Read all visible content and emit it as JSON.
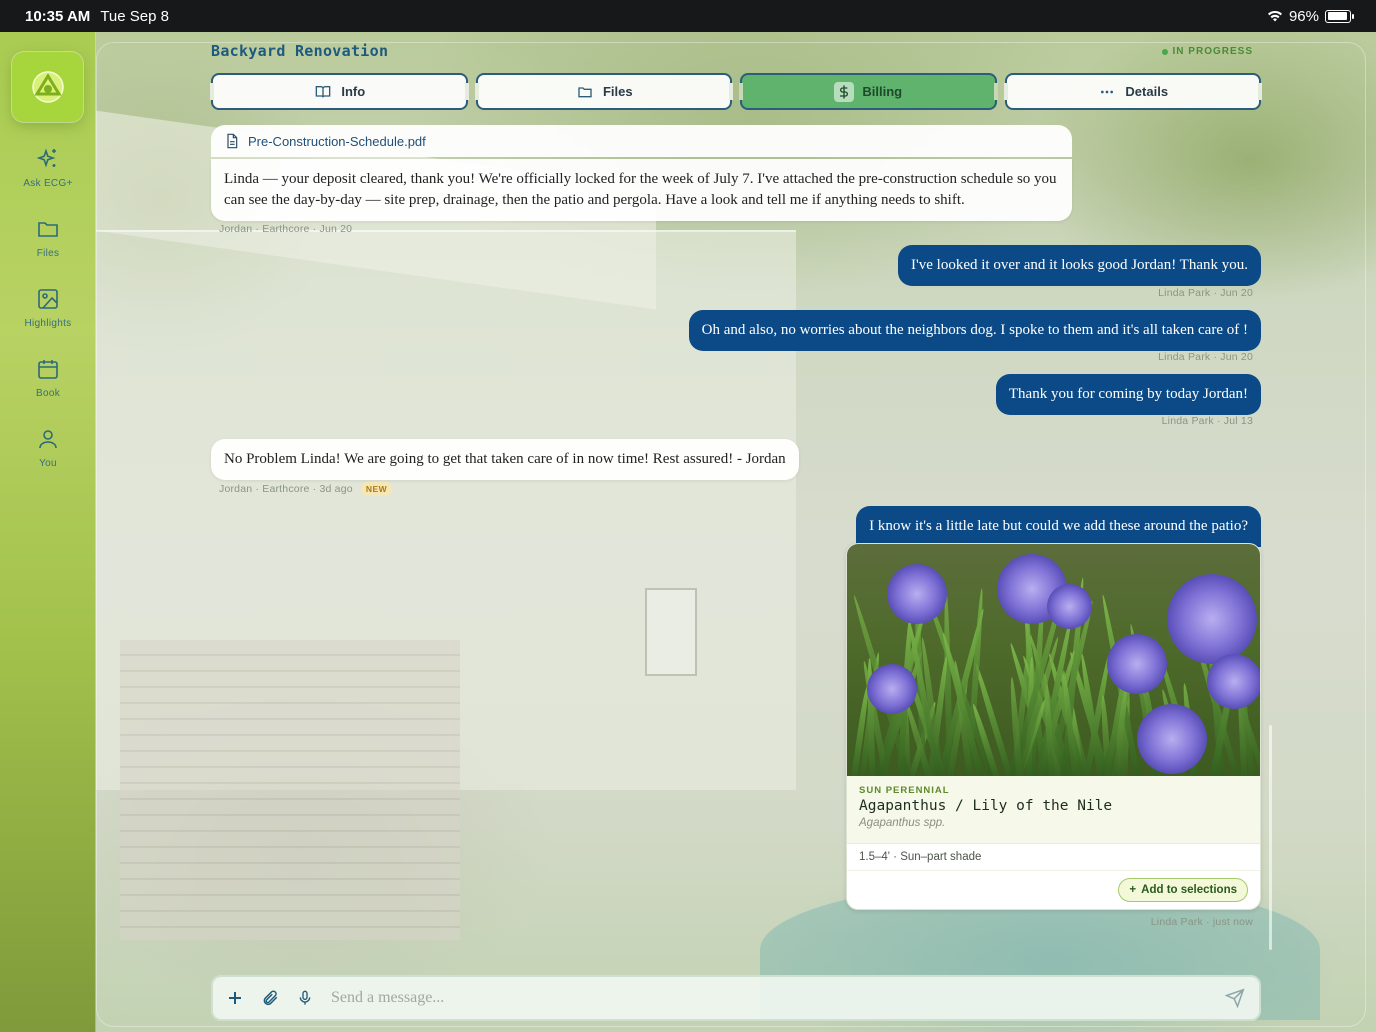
{
  "status_bar": {
    "time": "10:35 AM",
    "date": "Tue Sep 8",
    "battery": "96%"
  },
  "sidebar": {
    "items": [
      {
        "label": "Ask ECG+",
        "icon": "sparkles-icon"
      },
      {
        "label": "Files",
        "icon": "folder-icon"
      },
      {
        "label": "Highlights",
        "icon": "image-icon"
      },
      {
        "label": "Book",
        "icon": "calendar-icon"
      },
      {
        "label": "You",
        "icon": "person-icon"
      }
    ]
  },
  "header": {
    "title": "Backyard Renovation",
    "status": "IN PROGRESS"
  },
  "tabs": [
    {
      "label": "Info",
      "icon": "book-icon"
    },
    {
      "label": "Files",
      "icon": "folder-icon"
    },
    {
      "label": "Billing",
      "icon": "dollar-icon",
      "active": true
    },
    {
      "label": "Details",
      "icon": "ellipsis-icon"
    }
  ],
  "messages": [
    {
      "from": "in",
      "attachment": "Pre-Construction-Schedule.pdf",
      "text": "Linda — your deposit cleared, thank you! We're officially locked for the week of July 7. I've attached the pre-construction schedule so you can see the day-by-day — site prep, drainage, then the patio and pergola. Have a look and tell me if anything needs to shift.",
      "meta": "Jordan · Earthcore · Jun 20"
    },
    {
      "from": "out",
      "text": "I've looked it over and it looks good Jordan! Thank you.",
      "meta": "Linda Park · Jun 20"
    },
    {
      "from": "out",
      "text": "Oh and also, no worries about the neighbors dog. I spoke to them and it's all taken care of !",
      "meta": "Linda Park · Jun 20"
    },
    {
      "from": "out",
      "text": "Thank you for coming by today Jordan!",
      "meta": "Linda Park · Jul 13"
    },
    {
      "from": "in",
      "text": "No Problem Linda! We are going to get that taken care of in now time! Rest assured! - Jordan",
      "meta": "Jordan · Earthcore · 3d ago",
      "badge": "NEW"
    },
    {
      "from": "out",
      "text": "I know it's a little late but could we add these around the patio?",
      "meta": "Linda Park · just now"
    }
  ],
  "plant_card": {
    "category": "SUN PERENNIAL",
    "name": "Agapanthus / Lily of the Nile",
    "latin": "Agapanthus spp.",
    "specs": "1.5–4' · Sun–part shade",
    "button": "Add to selections"
  },
  "composer": {
    "placeholder": "Send a message..."
  },
  "colors": {
    "accent": "#0b4a86",
    "sidebar": "#a9cc52",
    "active_tab": "#5fb36c",
    "status": "#47a84a"
  }
}
